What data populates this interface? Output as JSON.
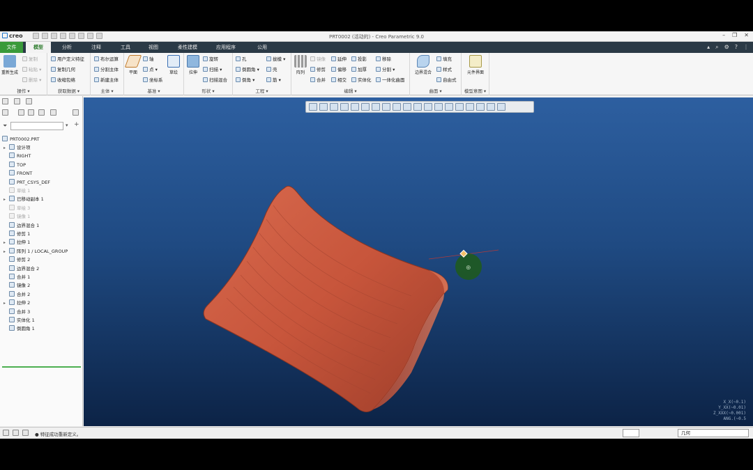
{
  "app": {
    "logo": "creo",
    "window_title": "PRT0002 (活动的) - Creo Parametric 9.0"
  },
  "tabs": [
    "文件",
    "模型",
    "分析",
    "注释",
    "工具",
    "视图",
    "柔性建模",
    "应用程序",
    "公用"
  ],
  "ribbon": {
    "groups": [
      {
        "label": "操作 ▾",
        "big": "重新生成",
        "rows": [
          "复制",
          "粘贴 ▾",
          "删除 ▾"
        ]
      },
      {
        "label": "获取数据 ▾",
        "rows": [
          "用户定义特征",
          "复制几何",
          "收缩包络"
        ]
      },
      {
        "label": "主体 ▾",
        "rows": [
          "布尔运算",
          "分割主体",
          "新建主体"
        ]
      },
      {
        "label": "基准 ▾",
        "big": "平面",
        "rows": [
          "轴",
          "点 ▾",
          "坐标系"
        ],
        "big2": "草绘"
      },
      {
        "label": "形状 ▾",
        "big": "拉伸",
        "rows": [
          "旋转",
          "扫描 ▾",
          "扫描混合"
        ]
      },
      {
        "label": "工程 ▾",
        "rows": [
          "孔",
          "倒圆角 ▾",
          "倒角 ▾"
        ],
        "rows2": [
          "拔模 ▾",
          "壳",
          "筋 ▾"
        ]
      },
      {
        "label": "编辑 ▾",
        "big": "阵列",
        "rows": [
          "镜像",
          "修剪",
          "合并"
        ],
        "rows2": [
          "延伸",
          "偏移",
          "相交"
        ],
        "rows3": [
          "投影",
          "加厚",
          "实体化"
        ],
        "rows4": [
          "移除",
          "分割 ▾",
          "一体化曲面"
        ]
      },
      {
        "label": "曲面 ▾",
        "big": "边界混合",
        "rows": [
          "填充",
          "样式",
          "自由式"
        ]
      },
      {
        "label": "模型意图 ▾",
        "big": "元件界面"
      }
    ]
  },
  "tree": {
    "root": "PRT0002.PRT",
    "items": [
      {
        "label": "设计项",
        "exp": "▸",
        "dim": false
      },
      {
        "label": "RIGHT",
        "exp": "",
        "dim": false
      },
      {
        "label": "TOP",
        "exp": "",
        "dim": false
      },
      {
        "label": "FRONT",
        "exp": "",
        "dim": false
      },
      {
        "label": "PRT_CSYS_DEF",
        "exp": "",
        "dim": false
      },
      {
        "label": "草绘 1",
        "exp": "",
        "dim": true
      },
      {
        "label": "已移动副本 1",
        "exp": "▸",
        "dim": false
      },
      {
        "label": "草绘 3",
        "exp": "",
        "dim": true
      },
      {
        "label": "镜像 1",
        "exp": "",
        "dim": true
      },
      {
        "label": "边界混合 1",
        "exp": "",
        "dim": false
      },
      {
        "label": "修剪 1",
        "exp": "",
        "dim": false
      },
      {
        "label": "拉伸 1",
        "exp": "▸",
        "dim": false
      },
      {
        "label": "阵列 1 / LOCAL_GROUP",
        "exp": "▸",
        "dim": false
      },
      {
        "label": "修剪 2",
        "exp": "",
        "dim": false
      },
      {
        "label": "边界混合 2",
        "exp": "",
        "dim": false
      },
      {
        "label": "合并 1",
        "exp": "",
        "dim": false
      },
      {
        "label": "镜像 2",
        "exp": "",
        "dim": false
      },
      {
        "label": "合并 2",
        "exp": "",
        "dim": false
      },
      {
        "label": "拉伸 2",
        "exp": "▸",
        "dim": false
      },
      {
        "label": "合并 3",
        "exp": "",
        "dim": false
      },
      {
        "label": "实体化 1",
        "exp": "",
        "dim": false
      },
      {
        "label": "倒圆角 1",
        "exp": "",
        "dim": false
      }
    ]
  },
  "viewport": {
    "coords": [
      "X_X(~0.1)",
      "Y_XX(~0.01)",
      "Z_XXX(~0.001)",
      "ANG.(~0.5"
    ],
    "model_color": "#c8563c"
  },
  "status": {
    "message": "● 特征成功重新定义。",
    "filter": "几何"
  }
}
